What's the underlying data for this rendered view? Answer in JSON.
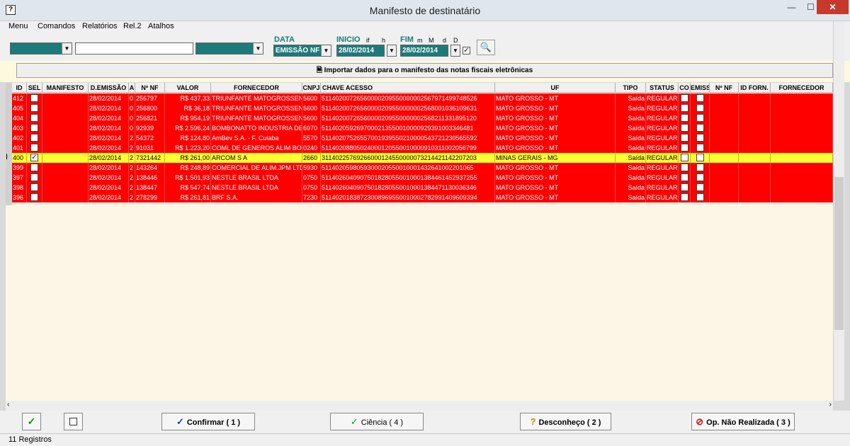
{
  "window": {
    "title": "Manifesto de destinatário",
    "app_icon": "?",
    "min": "—",
    "max": "☐",
    "close": "✕"
  },
  "menu": [
    "Menu",
    "Comandos",
    "Relatórios",
    "Rel.2",
    "Atalhos"
  ],
  "filters": {
    "data_label": "DATA",
    "data_value": "EMISSÃO NF",
    "inicio_label": "INICIO",
    "inicio_small": [
      "if",
      "h"
    ],
    "inicio_value": "28/02/2014",
    "fim_label": "FIM",
    "fim_small": [
      "m",
      "M",
      "d",
      "D"
    ],
    "fim_value": "28/02/2014",
    "check_mark": "✓"
  },
  "import_button": "Importar dados para o manifesto das notas fiscais eletrônicas",
  "columns": [
    "ID",
    "SEL",
    "MANIFESTO",
    "D.EMISSÃO",
    "A",
    "Nº NF",
    "VALOR",
    "FORNECEDOR",
    "CNPJ",
    "CHAVE ACESSO",
    "UF",
    "TIPO",
    "STATUS",
    "CO",
    "EMISS",
    "Nº NF",
    "ID FORN.",
    "FORNECEDOR"
  ],
  "rows": [
    {
      "id": "412",
      "sel": "",
      "manifesto": "",
      "demissao": "28/02/2014",
      "a": "0",
      "nf": "256797",
      "valor": "R$ 437,33",
      "fornecedor": "TRIUNFANTE MATOGROSSEN",
      "cnpj": "5600",
      "chave": "51140200726560000209550000002567971499748526",
      "uf": "MATO GROSSO - MT",
      "tipo": "Saída",
      "status": "REGULAR"
    },
    {
      "id": "405",
      "sel": "",
      "manifesto": "",
      "demissao": "28/02/2014",
      "a": "0",
      "nf": "256800",
      "valor": "R$ 36,18",
      "fornecedor": "TRIUNFANTE MATOGROSSEN",
      "cnpj": "5600",
      "chave": "51140200726560000209550000002568001036109631",
      "uf": "MATO GROSSO - MT",
      "tipo": "Saída",
      "status": "REGULAR"
    },
    {
      "id": "404",
      "sel": "",
      "manifesto": "",
      "demissao": "28/02/2014",
      "a": "0",
      "nf": "256821",
      "valor": "R$ 954,19",
      "fornecedor": "TRIUNFANTE MATOGROSSEN",
      "cnpj": "5600",
      "chave": "51140200726560000209550000002568211331895120",
      "uf": "MATO GROSSO - MT",
      "tipo": "Saída",
      "status": "REGULAR"
    },
    {
      "id": "403",
      "sel": "",
      "manifesto": "",
      "demissao": "28/02/2014",
      "a": "0",
      "nf": "92939",
      "valor": "R$ 2.596,24",
      "fornecedor": "BOMBONATTO INDUSTRIA DE",
      "cnpj": "6970",
      "chave": "51140205926970002135500100009293910033464​81",
      "uf": "MATO GROSSO - MT",
      "tipo": "Saída",
      "status": "REGULAR"
    },
    {
      "id": "402",
      "sel": "",
      "manifesto": "",
      "demissao": "28/02/2014",
      "a": "2",
      "nf": "54372",
      "valor": "R$ 124,80",
      "fornecedor": "AmBev S.A. - F. Cuiaba",
      "cnpj": "5570",
      "chave": "51140207526557001939550210000543721230565592",
      "uf": "MATO GROSSO - MT",
      "tipo": "Saída",
      "status": "REGULAR"
    },
    {
      "id": "401",
      "sel": "",
      "manifesto": "",
      "demissao": "28/02/2014",
      "a": "2",
      "nf": "91031",
      "valor": "R$ 1.223,20",
      "fornecedor": "COML DE GENEROS ALIM BOM",
      "cnpj": "0240",
      "chave": "51140208805024000120550010000910311002056799",
      "uf": "MATO GROSSO - MT",
      "tipo": "Saída",
      "status": "REGULAR"
    },
    {
      "id": "400",
      "sel": "✓",
      "manifesto": "",
      "demissao": "28/02/2014",
      "a": "2",
      "nf": "7321442",
      "valor": "R$ 261,00",
      "fornecedor": "ARCOM S A",
      "cnpj": "2660",
      "chave": "31140225769266000124550000073214421142207203",
      "uf": "MINAS GERAIS - MG",
      "tipo": "Saída",
      "status": "REGULAR",
      "selected": true
    },
    {
      "id": "399",
      "sel": "",
      "manifesto": "",
      "demissao": "28/02/2014",
      "a": "2",
      "nf": "143264",
      "valor": "R$ 248,89",
      "fornecedor": "COMERCIAL DE ALIM.JPM LTD",
      "cnpj": "5930",
      "chave": "51140205980593000205500100014326410022010​65",
      "uf": "MATO GROSSO - MT",
      "tipo": "Saída",
      "status": "REGULAR"
    },
    {
      "id": "397",
      "sel": "",
      "manifesto": "",
      "demissao": "28/02/2014",
      "a": "2",
      "nf": "138446",
      "valor": "R$ 1.501,93",
      "fornecedor": "NESTLE BRASIL LTDA",
      "cnpj": "0750",
      "chave": "51140260409075018280550010001384461452937255",
      "uf": "MATO GROSSO - MT",
      "tipo": "Saída",
      "status": "REGULAR"
    },
    {
      "id": "398",
      "sel": "",
      "manifesto": "",
      "demissao": "28/02/2014",
      "a": "2",
      "nf": "138447",
      "valor": "R$ 547,74",
      "fornecedor": "NESTLE BRASIL LTDA",
      "cnpj": "0750",
      "chave": "51140260409075018280550010001384471130036346",
      "uf": "MATO GROSSO - MT",
      "tipo": "Saída",
      "status": "REGULAR"
    },
    {
      "id": "396",
      "sel": "",
      "manifesto": "",
      "demissao": "28/02/2014",
      "a": "2",
      "nf": "278299",
      "valor": "R$ 261,81",
      "fornecedor": "BRF S.A.",
      "cnpj": "7230",
      "chave": "51140201838723008969550010002782991409609394",
      "uf": "MATO GROSSO - MT",
      "tipo": "Saída",
      "status": "REGULAR"
    }
  ],
  "row_indicator": "I",
  "buttons": {
    "check_all": "✓",
    "uncheck_all": "",
    "confirmar": "Confirmar ( 1 )",
    "ciencia": "Ciência ( 4 )",
    "desconheco": "Desconheço ( 2 )",
    "nao_realizada": "Op. Não Realizada ( 3 )"
  },
  "status": "11  Registros",
  "colors": {
    "row_red": "#ff0000",
    "row_selected": "#ffff33",
    "teal": "#1c7a7a",
    "grid_bg": "#fdf6e7"
  }
}
